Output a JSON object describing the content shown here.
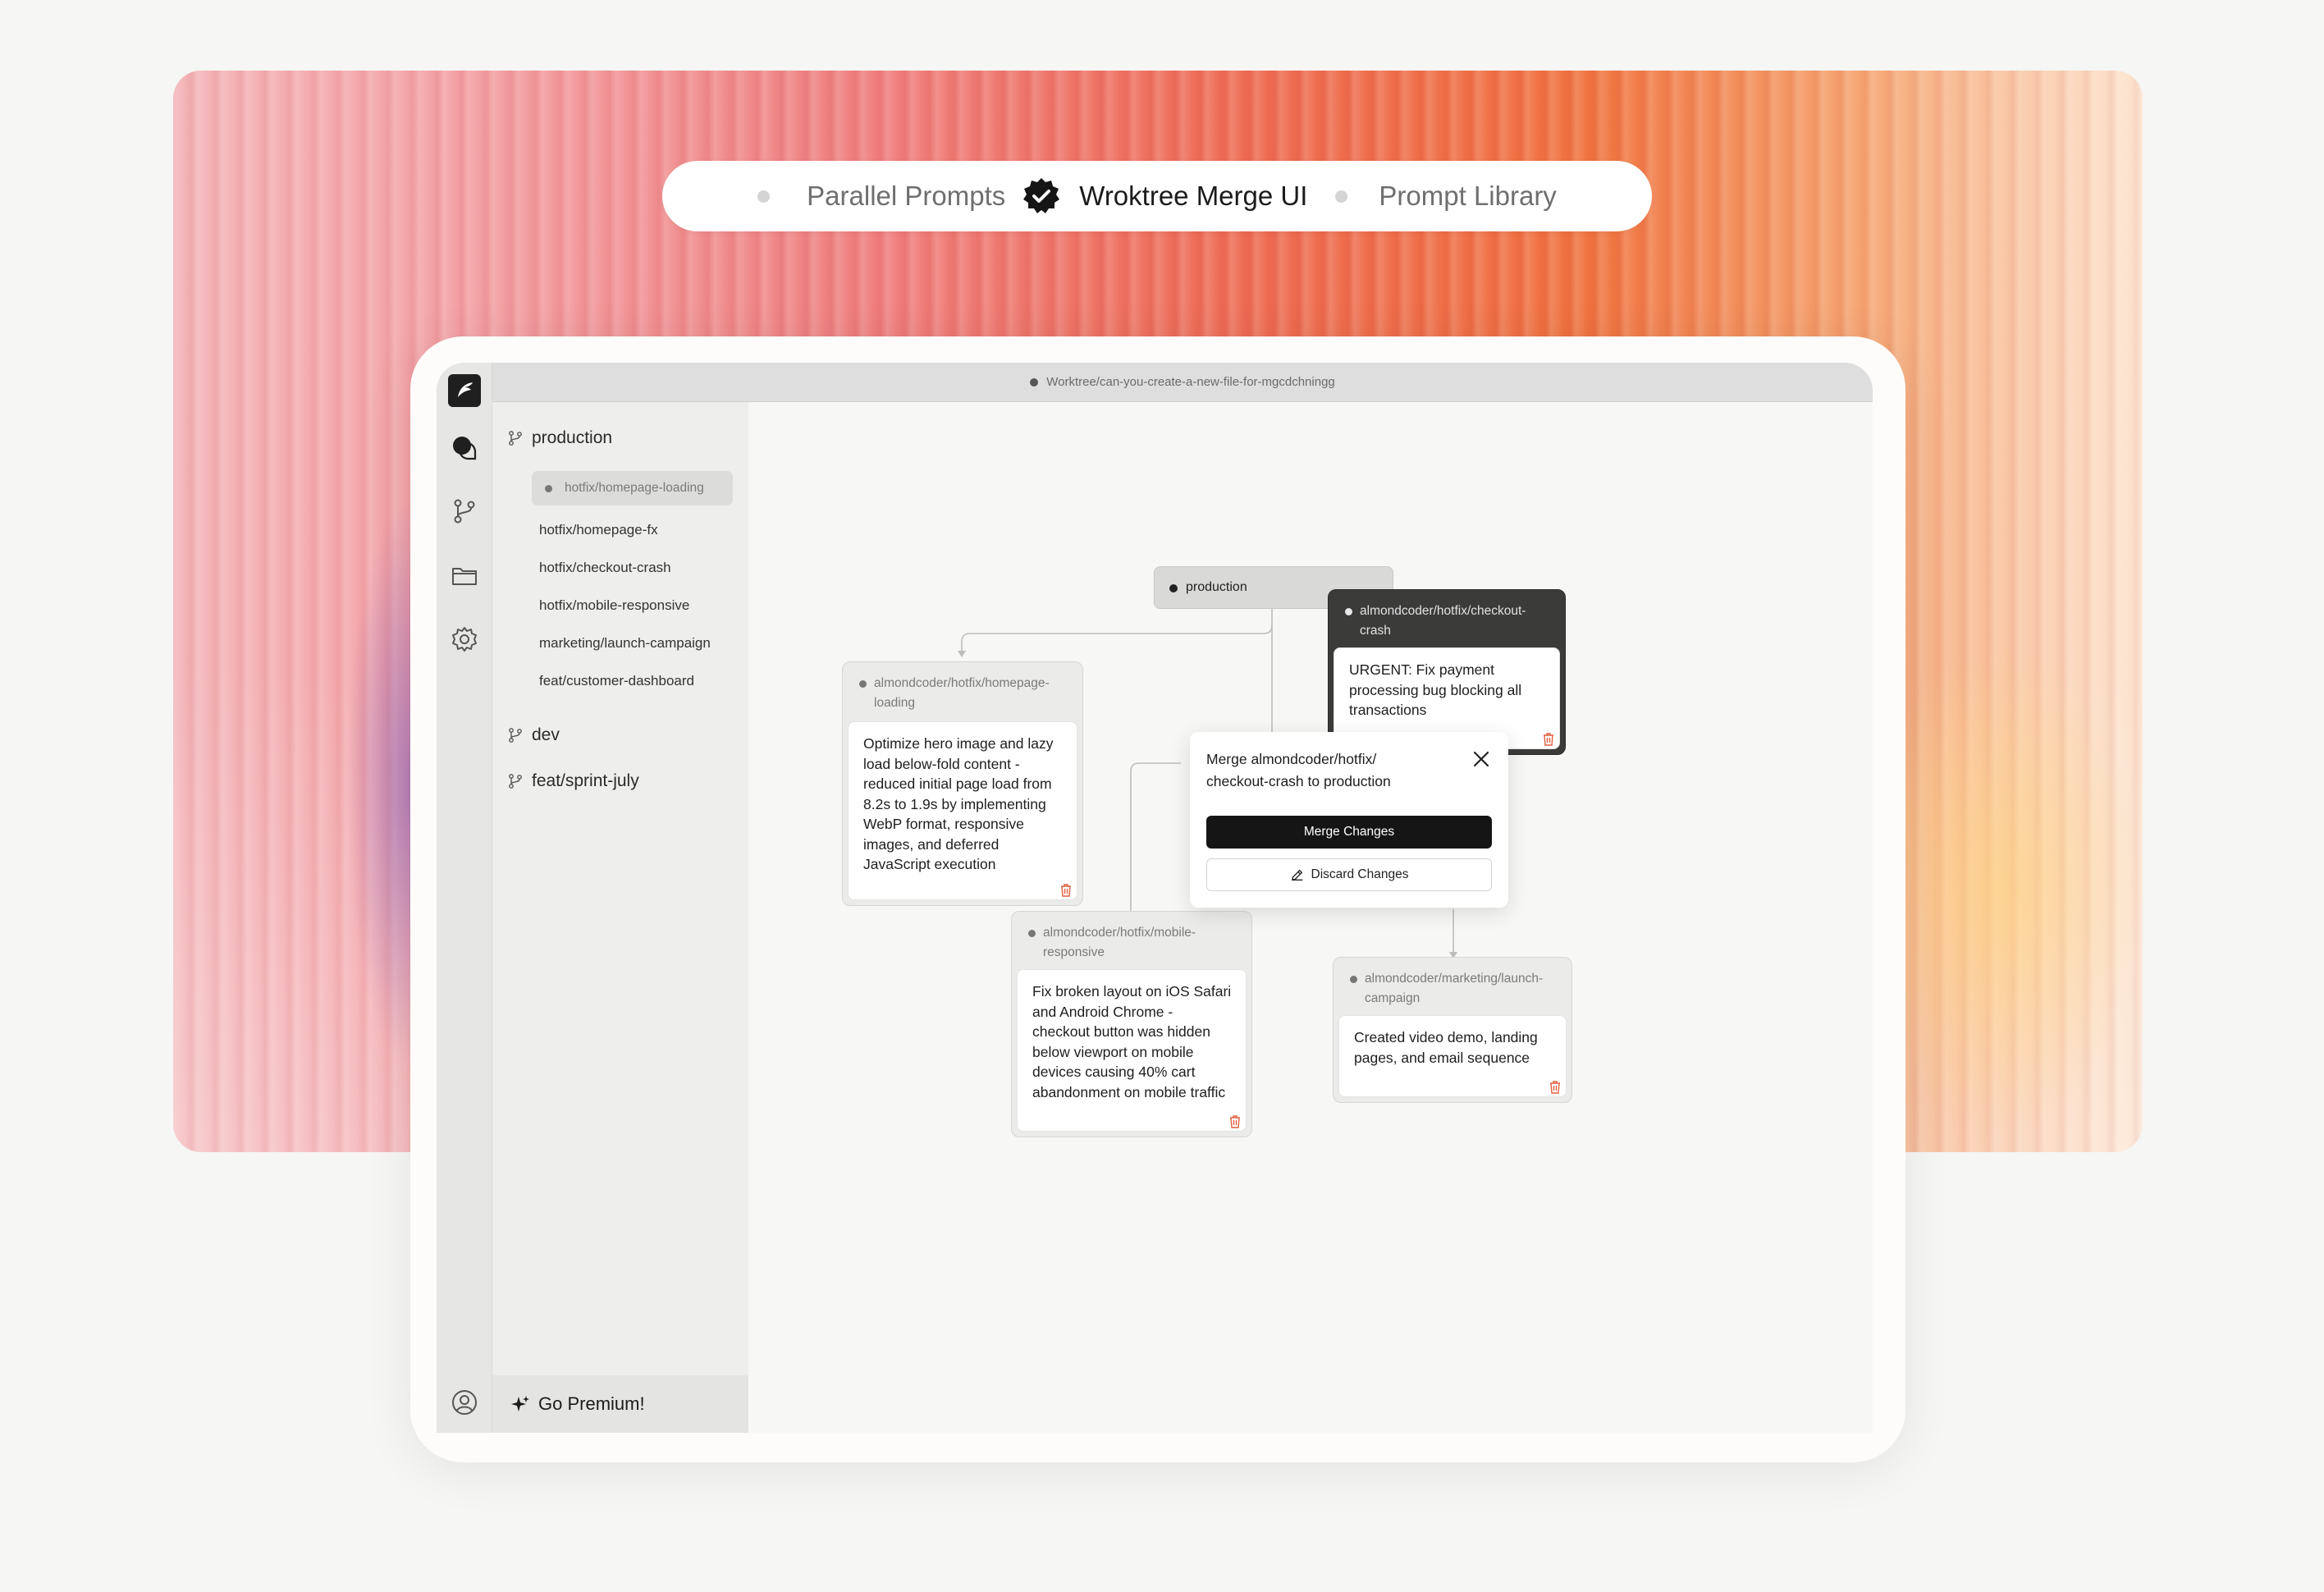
{
  "tabs": [
    {
      "label": "Parallel Prompts",
      "active": false
    },
    {
      "label": "Wroktree Merge UI",
      "active": true
    },
    {
      "label": "Prompt Library",
      "active": false
    }
  ],
  "app": {
    "window_title": "Worktree/can-you-create-a-new-file-for-mgcdchningg",
    "rail_icons": [
      "app-logo",
      "chat-icon",
      "branch-icon",
      "folder-icon",
      "gear-icon",
      "user-icon"
    ]
  },
  "sidebar": {
    "production": {
      "label": "production",
      "children": [
        {
          "label": "hotfix/homepage-loading",
          "selected": true
        },
        {
          "label": "hotfix/homepage-fx"
        },
        {
          "label": "hotfix/checkout-crash"
        },
        {
          "label": "hotfix/mobile-responsive"
        },
        {
          "label": "marketing/launch-campaign"
        },
        {
          "label": "feat/customer-dashboard"
        }
      ]
    },
    "dev": {
      "label": "dev"
    },
    "sprint": {
      "label": "feat/sprint-july"
    },
    "premium": "Go Premium!"
  },
  "graph": {
    "root": {
      "label": "production"
    },
    "nodes": [
      {
        "branch": "almondcoder/hotfix/homepage-loading",
        "text": "Optimize hero image and lazy load below-fold content - reduced initial page load from 8.2s to 1.9s by implementing WebP format, responsive images, and deferred JavaScript execution"
      },
      {
        "branch": "almondcoder/hotfix/checkout-crash",
        "text": "URGENT: Fix payment processing bug blocking all transactions",
        "active": true
      },
      {
        "branch": "almondcoder/hotfix/mobile-responsive",
        "text": "Fix broken layout on iOS Safari and Android Chrome - checkout button was hidden below viewport on mobile devices causing 40% cart abandonment on mobile traffic"
      },
      {
        "branch": "almondcoder/marketing/launch-campaign",
        "text": "Created video demo, landing pages, and email sequence"
      }
    ]
  },
  "merge_dialog": {
    "title": "Merge almondcoder/hotfix/ checkout-crash to production",
    "merge_label": "Merge Changes",
    "discard_label": "Discard Changes"
  },
  "colors": {
    "accent_dark": "#151515",
    "trash_icon": "#e0603f",
    "card_header_dark": "#3b3b3a"
  }
}
